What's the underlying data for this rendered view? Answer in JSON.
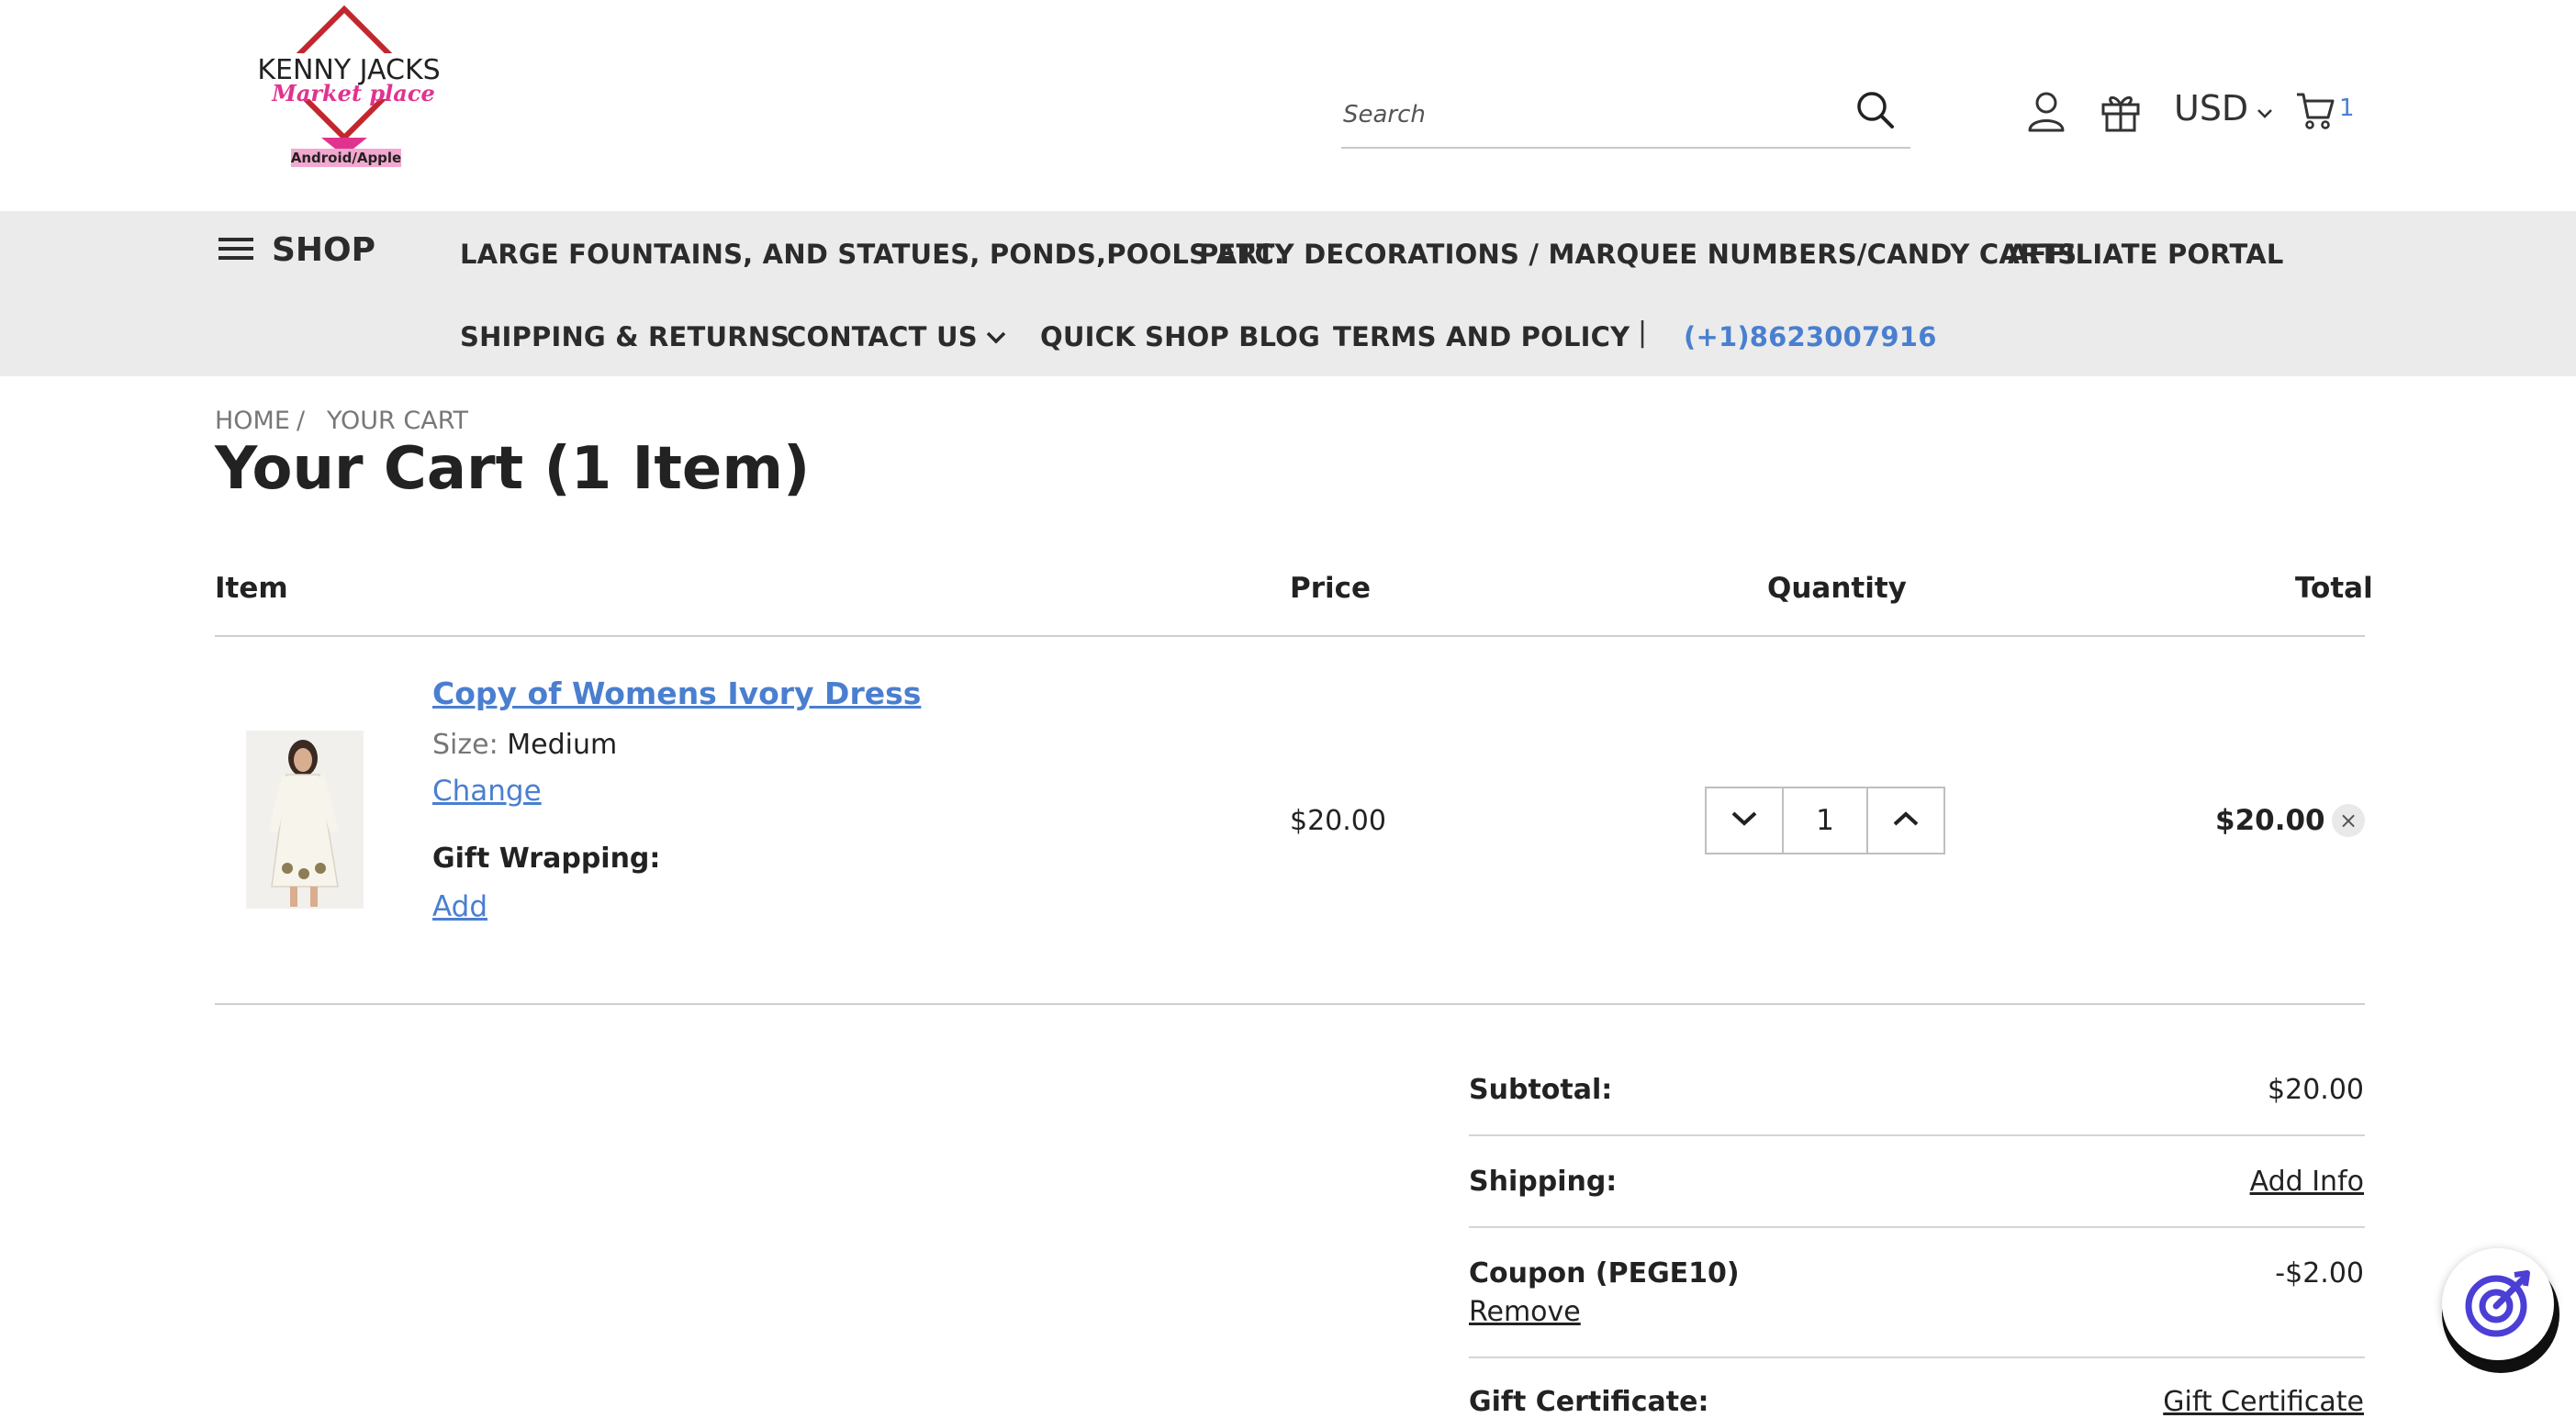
{
  "header": {
    "logo": {
      "line1": "KENNY JACKS",
      "line2": "Market place",
      "line3": "Android/Apple"
    },
    "search": {
      "placeholder": "Search",
      "value": ""
    },
    "currency": "USD",
    "cart_count": "1",
    "icons": [
      "search-icon",
      "account-icon",
      "gift-icon",
      "chevron-down-icon",
      "cart-icon"
    ]
  },
  "nav": {
    "shop_label": "SHOP",
    "items": [
      "LARGE FOUNTAINS, AND STATUES, PONDS,POOLS ETC.",
      "PARTY DECORATIONS / MARQUEE NUMBERS/CANDY CARTS",
      "AFFILIATE PORTAL",
      "SHIPPING & RETURNS",
      "CONTACT US",
      "QUICK SHOP BLOG",
      "TERMS AND POLICY"
    ],
    "separator": "|",
    "phone": "(+1)8623007916"
  },
  "breadcrumb": {
    "home": "HOME",
    "separator": "/",
    "current": "YOUR CART"
  },
  "page_title": "Your Cart (1 Item)",
  "table": {
    "headers": {
      "item": "Item",
      "price": "Price",
      "quantity": "Quantity",
      "total": "Total"
    },
    "rows": [
      {
        "name": "Copy of Womens Ivory Dress",
        "size_label": "Size:",
        "size_value": "Medium",
        "change_label": "Change",
        "gift_wrapping_label": "Gift Wrapping:",
        "gift_wrapping_action": "Add",
        "price": "$20.00",
        "quantity": "1",
        "total": "$20.00",
        "remove": "×"
      }
    ]
  },
  "totals": {
    "subtotal_label": "Subtotal:",
    "subtotal_value": "$20.00",
    "shipping_label": "Shipping:",
    "shipping_action": "Add Info",
    "coupon_label": "Coupon (PEGE10)",
    "coupon_remove": "Remove",
    "coupon_value": "-$2.00",
    "gift_cert_label": "Gift Certificate:",
    "gift_cert_action": "Gift Certificate"
  },
  "colors": {
    "link": "#4a7fd0",
    "nav_bg": "#ebebeb",
    "logo_red": "#c1272d",
    "logo_pink": "#e0338f"
  }
}
